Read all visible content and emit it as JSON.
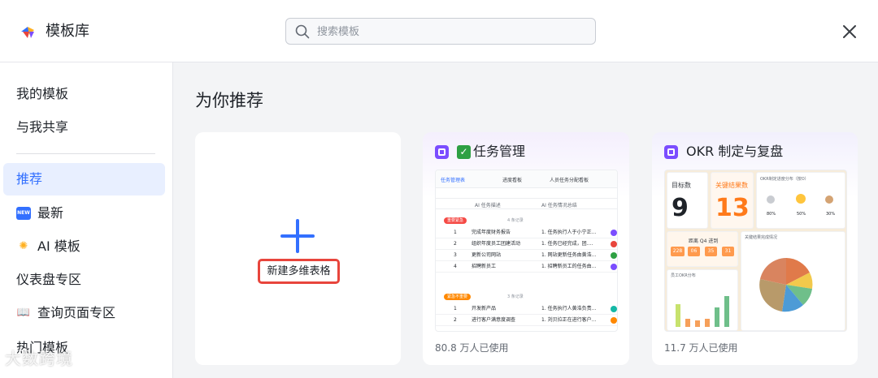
{
  "header": {
    "app_title": "模板库",
    "search_placeholder": "搜索模板"
  },
  "sidebar": {
    "items": [
      {
        "label": "我的模板",
        "icon": ""
      },
      {
        "label": "与我共享",
        "icon": ""
      },
      {
        "label": "推荐",
        "icon": "",
        "active": true
      },
      {
        "label": "最新",
        "icon": "new-badge-icon"
      },
      {
        "label": "AI 模板",
        "icon": "sparkle-icon"
      },
      {
        "label": "仪表盘专区",
        "icon": ""
      },
      {
        "label": "查询页面专区",
        "icon": "book-icon"
      },
      {
        "label": "热门模板",
        "icon": ""
      }
    ]
  },
  "main": {
    "title": "为你推荐",
    "new_card": {
      "label": "新建多维表格"
    },
    "cards": [
      {
        "title": "任务管理",
        "usage": "80.8 万人已使用",
        "preview": {
          "tabs": [
            "任务管理表",
            "进度看板",
            "人员任务分配看板"
          ],
          "columns": [
            "AI 任务描述",
            "AI 任务情况总结"
          ],
          "groups": [
            {
              "label": "重要紧急",
              "count": "4 条记录",
              "rows": [
                {
                  "n": "1",
                  "task": "完成年度财务报告",
                  "summary": "1. 任务执行人于小宁正..."
                },
                {
                  "n": "2",
                  "task": "组织年度员工团建活动",
                  "summary": "1. 任务已经完成，团...."
                },
                {
                  "n": "3",
                  "task": "更新公司网站",
                  "summary": "1. 网站更新任务由黄浩..."
                },
                {
                  "n": "4",
                  "task": "招聘新员工",
                  "summary": "1. 招聘新员工的任务由..."
                }
              ]
            },
            {
              "label": "紧急不重要",
              "count": "3 条记录",
              "rows": [
                {
                  "n": "1",
                  "task": "开发新产品",
                  "summary": "1. 任务执行人黄浩负责..."
                },
                {
                  "n": "2",
                  "task": "进行客户满意度调查",
                  "summary": "1. 刘贝拉正在进行客户..."
                }
              ]
            }
          ]
        }
      },
      {
        "title": "OKR 制定与复盘",
        "usage": "11.7 万人已使用",
        "preview": {
          "goal_label": "目标数",
          "goal_value": "9",
          "kr_label": "关键结果数",
          "kr_value": "13",
          "progress_title": "OKR制定进度分布（按O）",
          "badges": [
            "80%",
            "50%",
            "30%"
          ],
          "quarter_label": "距离 Q4 进到",
          "countdown": [
            "228",
            "06",
            "35",
            "31"
          ],
          "chart_title": "员工OKR分布",
          "pie_title": "关键结果完成情况"
        }
      }
    ]
  },
  "watermark": "大数跨境",
  "colors": {
    "accent": "#3370ff",
    "highlight_border": "#e8453c",
    "kr_orange": "#ff7a1a"
  }
}
